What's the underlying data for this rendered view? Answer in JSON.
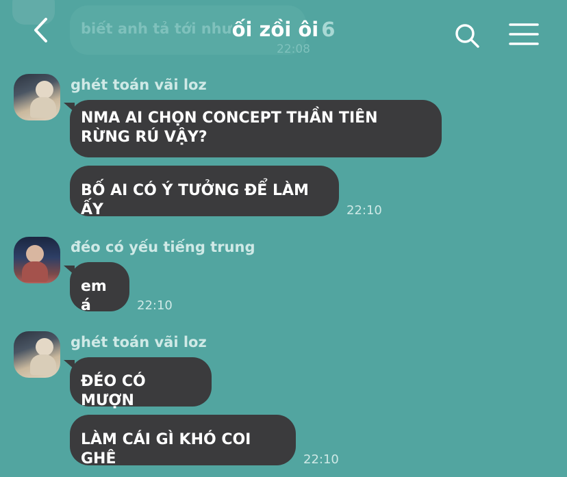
{
  "header": {
    "title": "ối zồi ôi",
    "member_count": "6",
    "back_icon": "chevron-left-icon",
    "search_icon": "search-icon",
    "menu_icon": "hamburger-menu-icon"
  },
  "previous_message": {
    "text": "biết anh tả tới như",
    "time": "22:08"
  },
  "messages": [
    {
      "sender": "ghét toán vãi loz",
      "bubbles": [
        "NMA AI CHỌN CONCEPT THẦN TIÊN RỪNG RÚ VẬY?",
        "BỐ AI CÓ Ý TƯỞNG ĐỂ LÀM ẤY"
      ],
      "time": "22:10"
    },
    {
      "sender": "đéo có yếu tiếng trung",
      "bubbles": [
        "em á"
      ],
      "time": "22:10"
    },
    {
      "sender": "ghét toán vãi loz",
      "bubbles": [
        "ĐÉO CÓ MƯỢN",
        "LÀM CÁI GÌ KHÓ COI GHÊ"
      ],
      "time": "22:10"
    }
  ],
  "colors": {
    "background": "#52a5a0",
    "bubble": "#3b3b3d",
    "text": "#ffffff",
    "meta_text": "#cfe9e6"
  }
}
